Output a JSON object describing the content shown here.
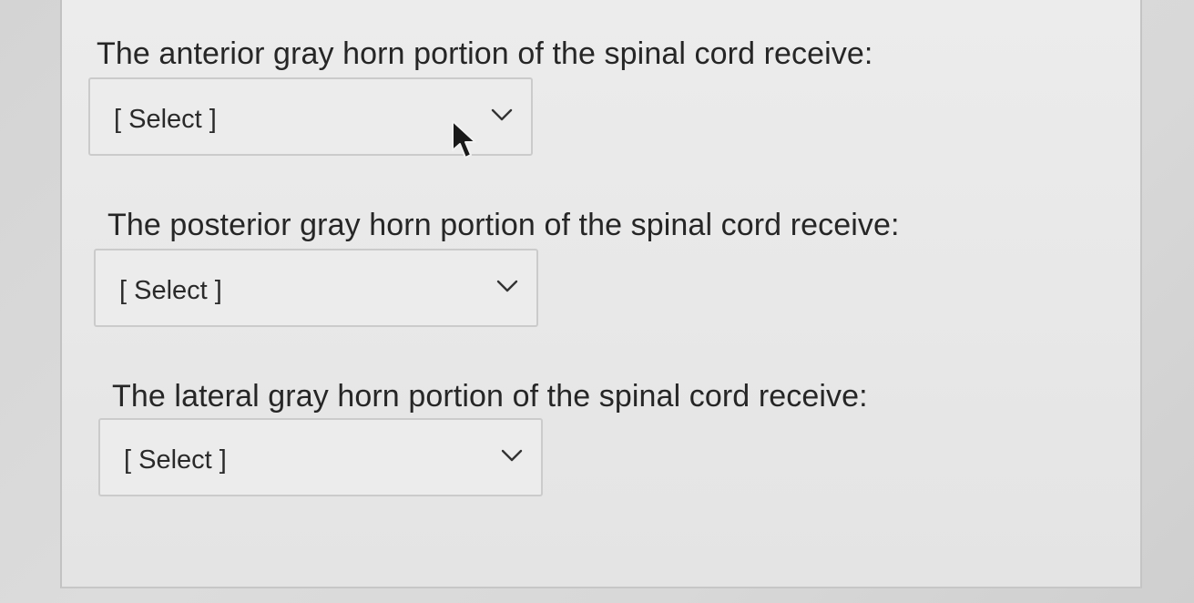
{
  "questions": [
    {
      "prompt": "The anterior gray horn portion of the spinal cord receive:",
      "select_value": "[ Select ]",
      "dropdown_icon": "chevron-down-icon"
    },
    {
      "prompt": "The posterior gray horn portion of the spinal cord receive:",
      "select_value": "[ Select ]",
      "dropdown_icon": "chevron-down-icon"
    },
    {
      "prompt": "The lateral gray horn portion of the spinal cord receive:",
      "select_value": "[ Select ]",
      "dropdown_icon": "chevron-down-icon"
    }
  ],
  "pointer": "mouse-cursor-icon",
  "colors": {
    "text": "#262626",
    "panel_background": "#e8e8e8",
    "border": "#cbcbcb"
  }
}
